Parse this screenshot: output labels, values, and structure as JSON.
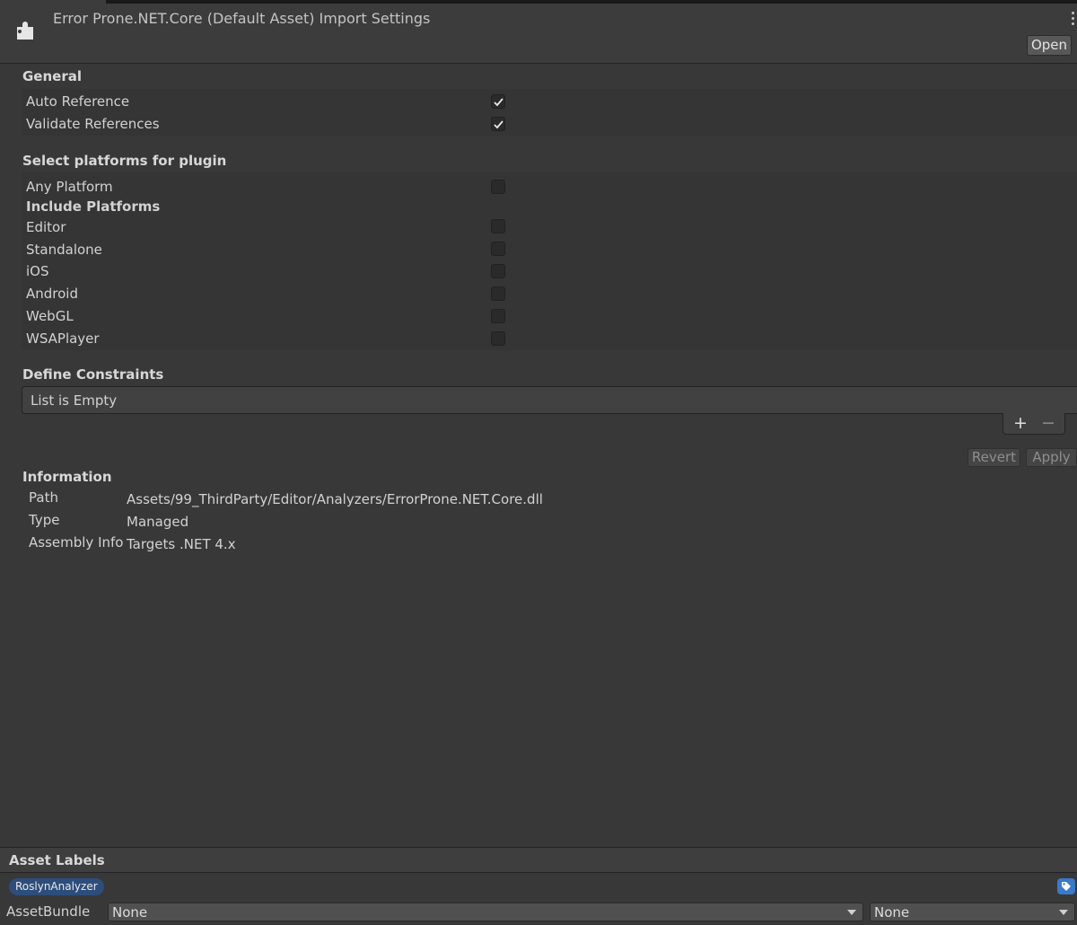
{
  "header": {
    "title": "Error Prone.NET.Core (Default Asset) Import Settings",
    "open_label": "Open",
    "icon": "puzzle-icon"
  },
  "general": {
    "heading": "General",
    "options": [
      {
        "label": "Auto Reference",
        "checked": true
      },
      {
        "label": "Validate References",
        "checked": true
      }
    ]
  },
  "platforms": {
    "heading": "Select platforms for plugin",
    "any_platform": {
      "label": "Any Platform",
      "checked": false
    },
    "include_heading": "Include Platforms",
    "items": [
      {
        "label": "Editor",
        "checked": false
      },
      {
        "label": "Standalone",
        "checked": false
      },
      {
        "label": "iOS",
        "checked": false
      },
      {
        "label": "Android",
        "checked": false
      },
      {
        "label": "WebGL",
        "checked": false
      },
      {
        "label": "WSAPlayer",
        "checked": false
      }
    ]
  },
  "constraints": {
    "heading": "Define Constraints",
    "empty_text": "List is Empty",
    "add_symbol": "+",
    "remove_symbol": "−"
  },
  "actions": {
    "revert_label": "Revert",
    "apply_label": "Apply"
  },
  "information": {
    "heading": "Information",
    "rows": [
      {
        "key": "Path",
        "value": "Assets/99_ThirdParty/Editor/Analyzers/ErrorProne.NET.Core.dll"
      },
      {
        "key": "Type",
        "value": "Managed"
      },
      {
        "key": "Assembly Info",
        "value": "Targets .NET 4.x"
      }
    ]
  },
  "asset_labels": {
    "heading": "Asset Labels",
    "tags": [
      "RoslynAnalyzer"
    ],
    "tag_icon": "tag-icon"
  },
  "asset_bundle": {
    "label": "AssetBundle",
    "name_value": "None",
    "variant_value": "None"
  },
  "colors": {
    "background": "#383838",
    "tag_chip": "#2d4e7c",
    "tag_icon": "#3b79c9"
  }
}
